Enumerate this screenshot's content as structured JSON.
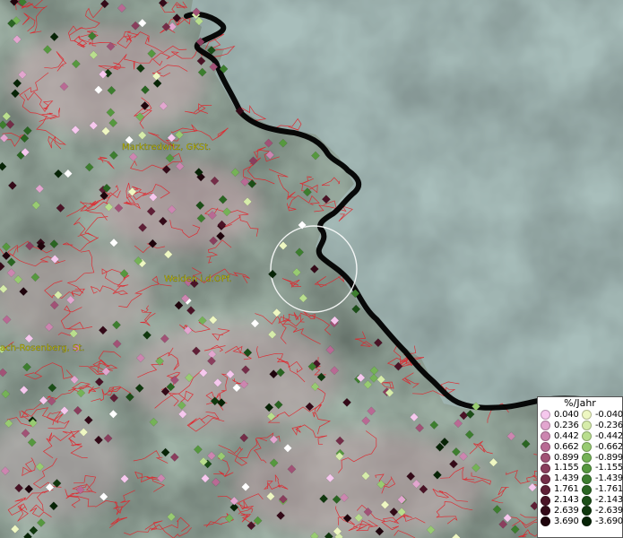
{
  "map": {
    "place_labels": [
      {
        "text": "Marktredwitz, GKSt."
      },
      {
        "text": "Weiden i.d.OPf."
      },
      {
        "text": "ach-Rosenberg, St."
      }
    ],
    "colors": {
      "land": "#9fb2a6",
      "sea": "#a9c0bd",
      "district_borders": "#e2232a",
      "national_border": "#000000",
      "label": "#d8d200",
      "highlight_circle": "#ffffff"
    }
  },
  "legend": {
    "title": "%/Jahr",
    "rows": [
      {
        "pos": "0.040",
        "pos_color": "#f6c8ee",
        "neg": "-0.040",
        "neg_color": "#eef7c2"
      },
      {
        "pos": "0.236",
        "pos_color": "#e2a6cf",
        "neg": "-0.236",
        "neg_color": "#d6ecaa"
      },
      {
        "pos": "0.442",
        "pos_color": "#cc86b0",
        "neg": "-0.442",
        "neg_color": "#b9de8e"
      },
      {
        "pos": "0.662",
        "pos_color": "#b86a94",
        "neg": "-0.662",
        "neg_color": "#98cb72"
      },
      {
        "pos": "0.899",
        "pos_color": "#a15276",
        "neg": "-0.899",
        "neg_color": "#75b257"
      },
      {
        "pos": "1.155",
        "pos_color": "#8a3e5d",
        "neg": "-1.155",
        "neg_color": "#56983f"
      },
      {
        "pos": "1.439",
        "pos_color": "#742d48",
        "neg": "-1.439",
        "neg_color": "#3d7e2f"
      },
      {
        "pos": "1.761",
        "pos_color": "#5f1f36",
        "neg": "-1.761",
        "neg_color": "#2a6522"
      },
      {
        "pos": "2.143",
        "pos_color": "#4a1326",
        "neg": "-2.143",
        "neg_color": "#1b4e17"
      },
      {
        "pos": "2.639",
        "pos_color": "#340a18",
        "neg": "-2.639",
        "neg_color": "#10380e"
      },
      {
        "pos": "3.690",
        "pos_color": "#1f040c",
        "neg": "-3.690",
        "neg_color": "#072406"
      }
    ]
  }
}
